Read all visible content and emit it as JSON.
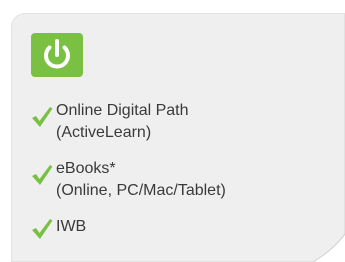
{
  "badge": {
    "icon": "power-icon",
    "color": "#7ac143"
  },
  "check_icon": "checkmark-icon",
  "check_color": "#7ac143",
  "items": [
    {
      "line1": "Online Digital Path",
      "line2": "(ActiveLearn)"
    },
    {
      "line1": "eBooks*",
      "line2": "(Online, PC/Mac/Tablet)"
    },
    {
      "line1": "IWB",
      "line2": ""
    }
  ]
}
